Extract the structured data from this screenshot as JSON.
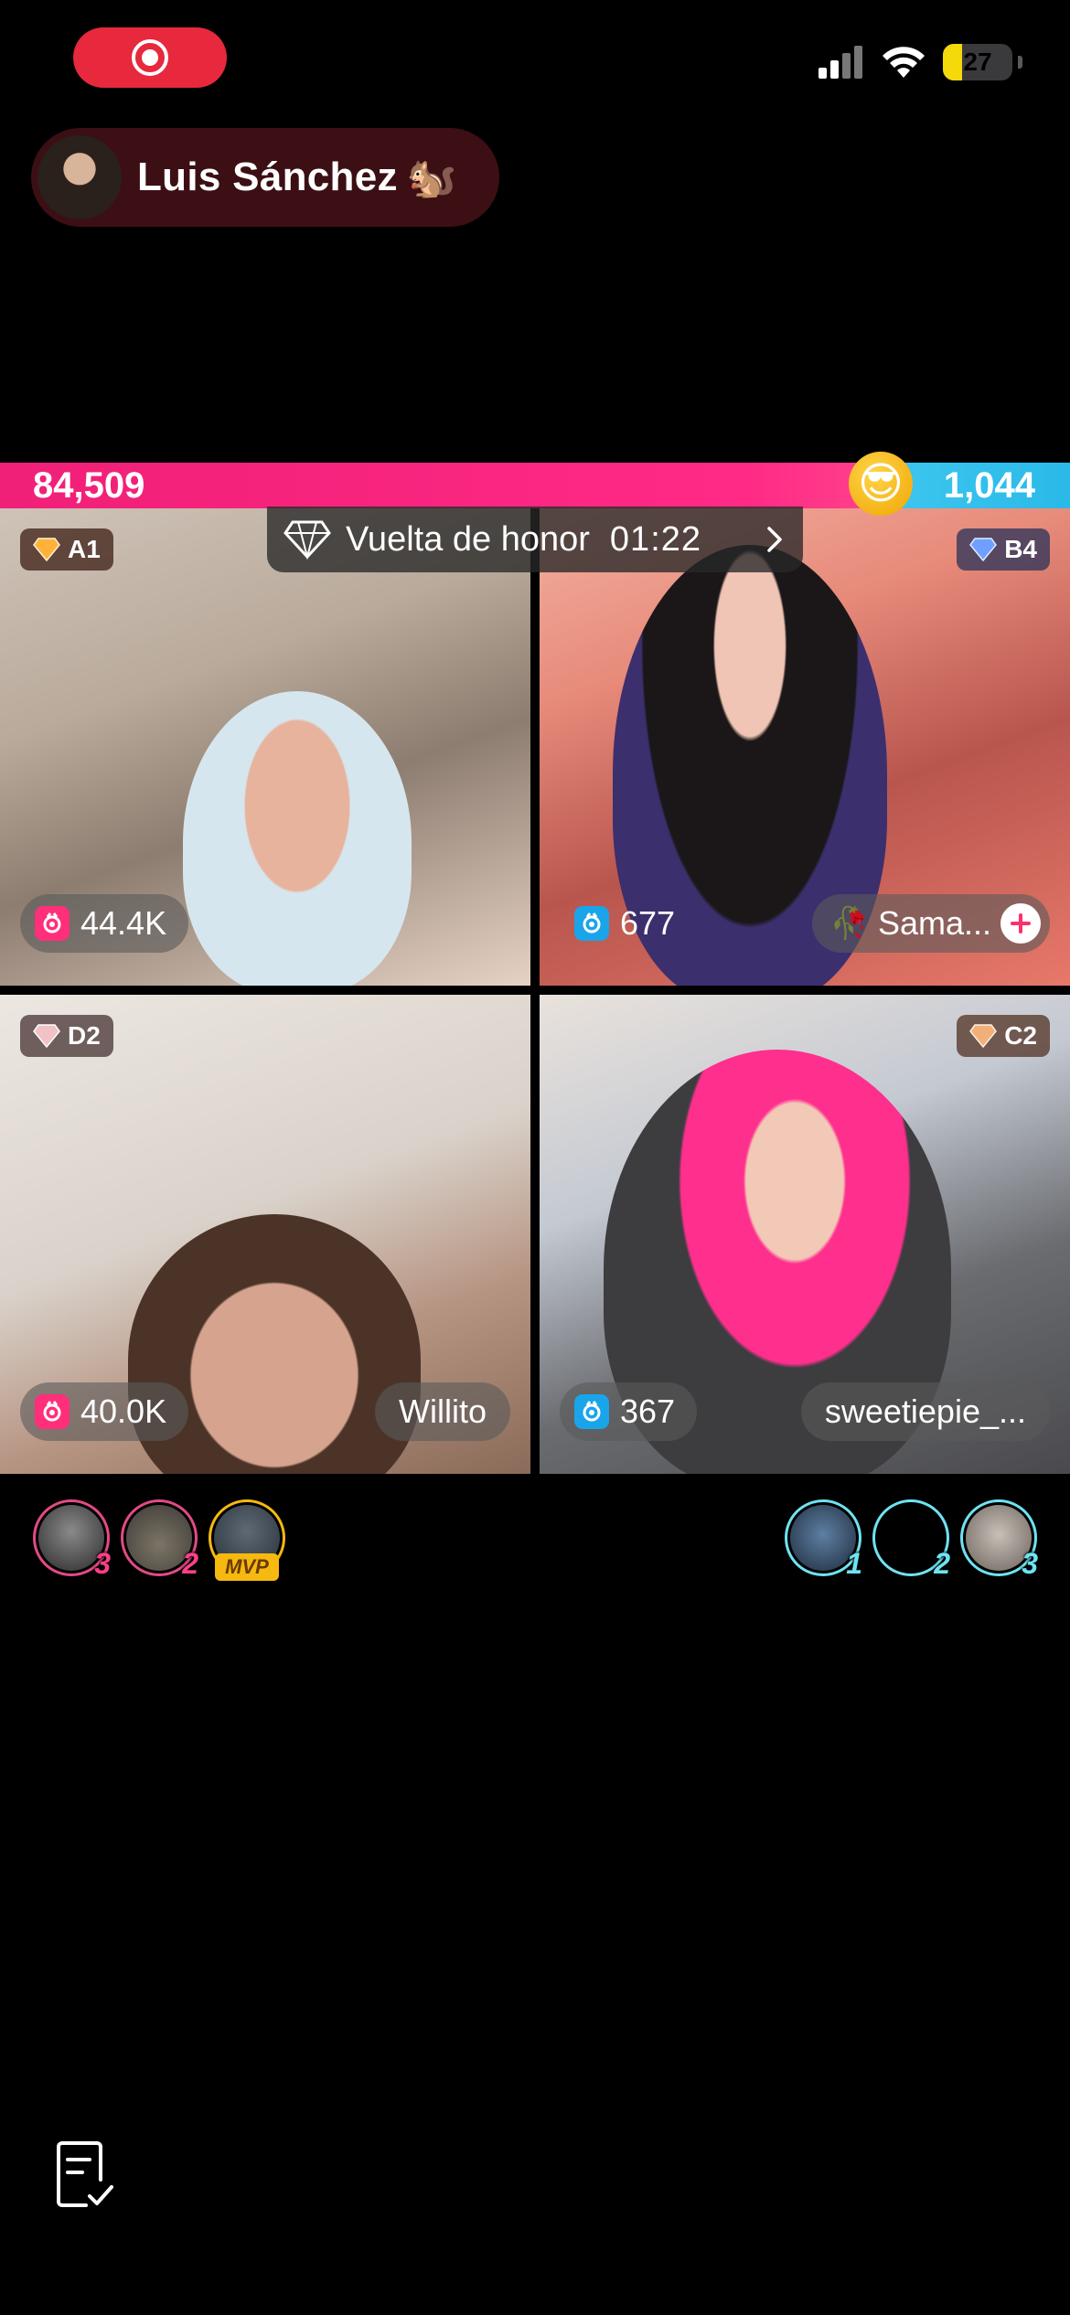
{
  "status_bar": {
    "battery_level": "27",
    "battery_fill_percent": 27,
    "icons": [
      "record-icon",
      "signal-icon",
      "wifi-icon",
      "battery-icon"
    ]
  },
  "host": {
    "name": "Luis Sánchez",
    "emoji": "🐿️"
  },
  "battle": {
    "score_left": "84,509",
    "score_right": "1,044",
    "score_emoji": "😎",
    "banner_title": "Vuelta de honor",
    "banner_time": "01:22",
    "colors": {
      "left": "#f01f77",
      "right": "#2ab9e8"
    }
  },
  "tiles": [
    {
      "rank": "A1",
      "gift_count": "44.4K",
      "gift_color": "pink",
      "name": ""
    },
    {
      "rank": "B4",
      "gift_count": "677",
      "gift_color": "blue",
      "name": "Sama...",
      "name_emoji": "🥀"
    },
    {
      "rank": "D2",
      "gift_count": "40.0K",
      "gift_color": "pink",
      "name": "Willito"
    },
    {
      "rank": "C2",
      "gift_count": "367",
      "gift_color": "blue",
      "name": "sweetiepie_..."
    }
  ],
  "supporters": {
    "left": [
      {
        "rank": "3"
      },
      {
        "rank": "2"
      },
      {
        "badge": "MVP"
      }
    ],
    "right": [
      {
        "rank": "1"
      },
      {
        "rank": "2"
      },
      {
        "rank": "3"
      }
    ]
  }
}
